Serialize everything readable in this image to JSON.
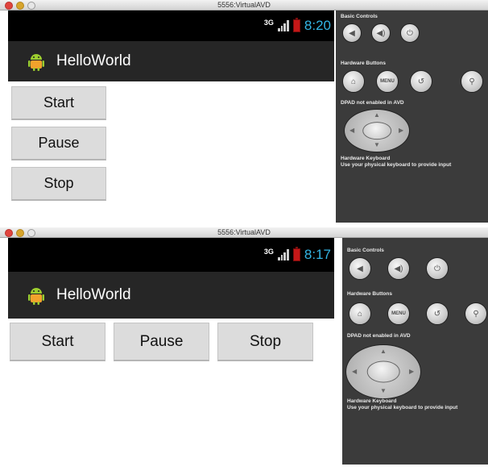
{
  "windows": [
    {
      "title": "5556:VirtualAVD",
      "status": {
        "network": "3G",
        "time": "8:20"
      },
      "app_title": "HelloWorld",
      "buttons": [
        "Start",
        "Pause",
        "Stop"
      ],
      "panel": {
        "basic_controls": "Basic Controls",
        "hardware_buttons": "Hardware Buttons",
        "menu_label": "MENU",
        "dpad_note": "DPAD not enabled in AVD",
        "keyboard_title": "Hardware Keyboard",
        "keyboard_note": "Use your physical keyboard to provide input"
      }
    },
    {
      "title": "5556:VirtualAVD",
      "status": {
        "network": "3G",
        "time": "8:17"
      },
      "app_title": "HelloWorld",
      "buttons": [
        "Start",
        "Pause",
        "Stop"
      ],
      "panel": {
        "basic_controls": "Basic Controls",
        "hardware_buttons": "Hardware Buttons",
        "menu_label": "MENU",
        "dpad_note": "DPAD not enabled in AVD",
        "keyboard_title": "Hardware Keyboard",
        "keyboard_note": "Use your physical keyboard to provide input"
      }
    }
  ],
  "colors": {
    "clock": "#33b5e5",
    "action_bar": "#262626",
    "panel": "#3b3b3b",
    "button": "#dcdcdc"
  },
  "icons": [
    "android-icon",
    "volume-down-icon",
    "volume-up-icon",
    "power-icon",
    "home-icon",
    "menu-button",
    "back-icon",
    "search-icon",
    "dpad"
  ]
}
